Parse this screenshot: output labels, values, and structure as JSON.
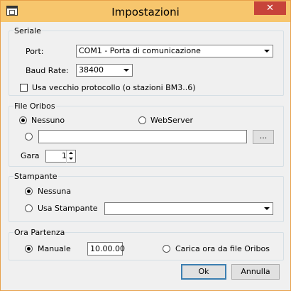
{
  "window": {
    "title": "Impostazioni",
    "close_label": "✕"
  },
  "seriale": {
    "legend": "Seriale",
    "port_label": "Port:",
    "port_value": "COM1 - Porta di comunicazione",
    "baud_label": "Baud Rate:",
    "baud_value": "38400",
    "old_protocol_label": "Usa vecchio protocollo (o stazioni BM3..6)",
    "old_protocol_checked": false
  },
  "file_oribos": {
    "legend": "File Oribos",
    "nessuno_label": "Nessuno",
    "webserver_label": "WebServer",
    "path_value": "",
    "browse_label": "...",
    "gara_label": "Gara",
    "gara_value": "1",
    "selected": "nessuno"
  },
  "stampante": {
    "legend": "Stampante",
    "nessuna_label": "Nessuna",
    "usa_label": "Usa Stampante",
    "printer_value": "",
    "selected": "nessuna"
  },
  "ora_partenza": {
    "legend": "Ora Partenza",
    "manuale_label": "Manuale",
    "time_value": "10.00.00",
    "carica_label": "Carica ora da file Oribos",
    "selected": "manuale"
  },
  "buttons": {
    "ok_label": "Ok",
    "cancel_label": "Annulla"
  }
}
